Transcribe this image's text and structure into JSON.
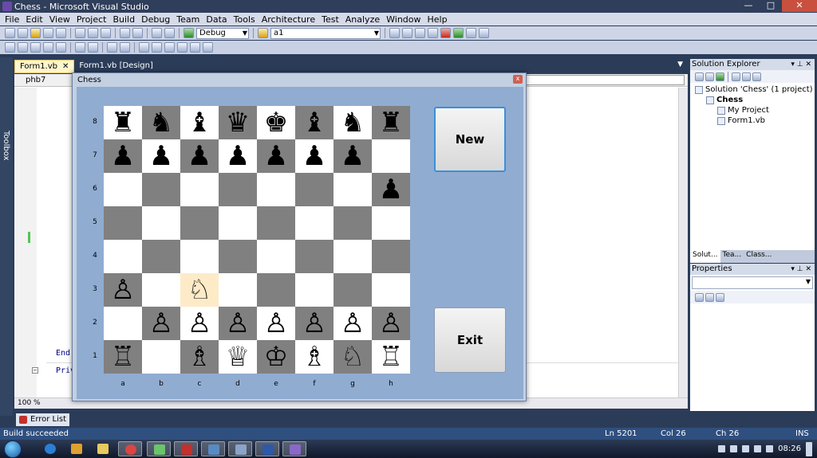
{
  "window": {
    "title": "Chess - Microsoft Visual Studio",
    "buttons": [
      "—",
      "□",
      "✕"
    ]
  },
  "menu": [
    "File",
    "Edit",
    "View",
    "Project",
    "Build",
    "Debug",
    "Team",
    "Data",
    "Tools",
    "Architecture",
    "Test",
    "Analyze",
    "Window",
    "Help"
  ],
  "toolbar": {
    "config": "Debug",
    "find": "a1"
  },
  "toolbox": {
    "label": "Toolbox"
  },
  "doc_tabs": [
    {
      "label": "Form1.vb",
      "active": true
    },
    {
      "label": "Form1.vb [Design]",
      "active": false
    }
  ],
  "editor": {
    "nav_left": "phb7",
    "code_end": "End",
    "code_priv": "Priv",
    "zoom": "100 %"
  },
  "chess_form": {
    "title": "Chess",
    "close": "x",
    "new_button": "New",
    "exit_button": "Exit",
    "files": [
      "a",
      "b",
      "c",
      "d",
      "e",
      "f",
      "g",
      "h"
    ],
    "ranks": [
      "8",
      "7",
      "6",
      "5",
      "4",
      "3",
      "2",
      "1"
    ],
    "highlight": "c3",
    "board": [
      [
        "♜",
        "♞",
        "♝",
        "♛",
        "♚",
        "♝",
        "♞",
        "♜"
      ],
      [
        "♟",
        "♟",
        "♟",
        "♟",
        "♟",
        "♟",
        "♟",
        ""
      ],
      [
        "",
        "",
        "",
        "",
        "",
        "",
        "",
        "♟"
      ],
      [
        "",
        "",
        "",
        "",
        "",
        "",
        "",
        ""
      ],
      [
        "",
        "",
        "",
        "",
        "",
        "",
        "",
        ""
      ],
      [
        "♙",
        "",
        "♘",
        "",
        "",
        "",
        "",
        ""
      ],
      [
        "",
        "♙",
        "♙",
        "♙",
        "♙",
        "♙",
        "♙",
        "♙"
      ],
      [
        "♖",
        "",
        "♗",
        "♕",
        "♔",
        "♗",
        "♘",
        "♖"
      ]
    ]
  },
  "solution_explorer": {
    "title": "Solution Explorer",
    "items": [
      {
        "label": "Solution 'Chess' (1 project)",
        "indent": 0
      },
      {
        "label": "Chess",
        "indent": 1,
        "bold": true
      },
      {
        "label": "My Project",
        "indent": 2
      },
      {
        "label": "Form1.vb",
        "indent": 2
      }
    ],
    "tabs": [
      "Solut...",
      "Tea...",
      "Class..."
    ]
  },
  "properties": {
    "title": "Properties"
  },
  "error_list": {
    "label": "Error List"
  },
  "status": {
    "message": "Build succeeded",
    "ln": "Ln 5201",
    "col": "Col 26",
    "ch": "Ch 26",
    "ins": "INS"
  },
  "taskbar": {
    "time": "08:26"
  }
}
